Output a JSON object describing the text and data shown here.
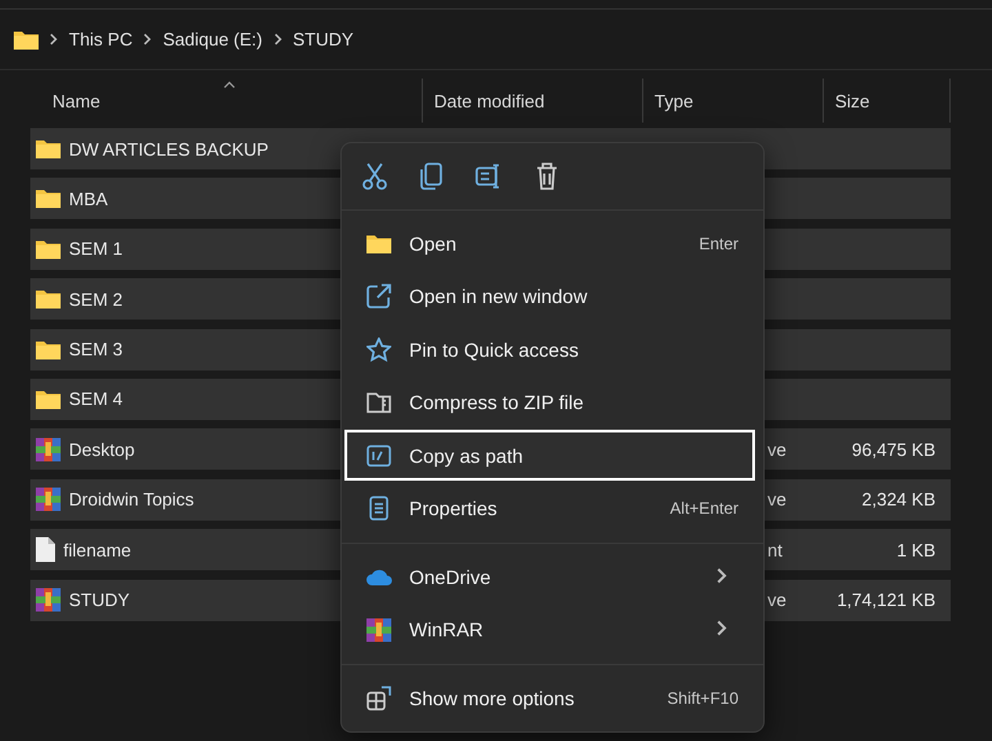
{
  "breadcrumb": [
    "This PC",
    "Sadique (E:)",
    "STUDY"
  ],
  "columns": [
    {
      "label": "Name",
      "sorted": true
    },
    {
      "label": "Date modified",
      "sorted": false
    },
    {
      "label": "Type",
      "sorted": false
    },
    {
      "label": "Size",
      "sorted": false
    }
  ],
  "rows": [
    {
      "kind": "folder",
      "name": "DW ARTICLES BACKUP",
      "selected": true
    },
    {
      "kind": "folder",
      "name": "MBA",
      "selected": true
    },
    {
      "kind": "folder",
      "name": "SEM 1",
      "selected": true
    },
    {
      "kind": "folder",
      "name": "SEM 2",
      "selected": true
    },
    {
      "kind": "folder",
      "name": "SEM 3",
      "selected": true
    },
    {
      "kind": "folder",
      "name": "SEM 4",
      "selected": true
    },
    {
      "kind": "archive",
      "name": "Desktop",
      "type": "ve",
      "size": "96,475 KB",
      "selected": true
    },
    {
      "kind": "archive",
      "name": "Droidwin Topics",
      "type": "ve",
      "size": "2,324 KB",
      "selected": true
    },
    {
      "kind": "file",
      "name": "filename",
      "type": "nt",
      "size": "1 KB",
      "selected": true
    },
    {
      "kind": "archive",
      "name": "STUDY",
      "type": "ve",
      "size": "1,74,121 KB",
      "selected": true
    }
  ],
  "context_menu": {
    "toolbar": [
      {
        "kind": "cut"
      },
      {
        "kind": "copy"
      },
      {
        "kind": "rename"
      },
      {
        "kind": "delete"
      }
    ],
    "groups": [
      [
        {
          "kind": "folder",
          "label": "Open",
          "shortcut": "Enter",
          "highlighted": false
        },
        {
          "kind": "open-new",
          "label": "Open in new window",
          "highlighted": false
        },
        {
          "kind": "star",
          "label": "Pin to Quick access",
          "highlighted": false
        },
        {
          "kind": "zip",
          "label": "Compress to ZIP file",
          "highlighted": false
        },
        {
          "kind": "path",
          "label": "Copy as path",
          "highlighted": true
        },
        {
          "kind": "properties",
          "label": "Properties",
          "shortcut": "Alt+Enter",
          "highlighted": false
        }
      ],
      [
        {
          "kind": "cloud",
          "label": "OneDrive",
          "submenu": true,
          "highlighted": false
        },
        {
          "kind": "archive",
          "label": "WinRAR",
          "submenu": true,
          "highlighted": false
        }
      ],
      [
        {
          "kind": "more",
          "label": "Show more options",
          "shortcut": "Shift+F10",
          "highlighted": false
        }
      ]
    ]
  }
}
